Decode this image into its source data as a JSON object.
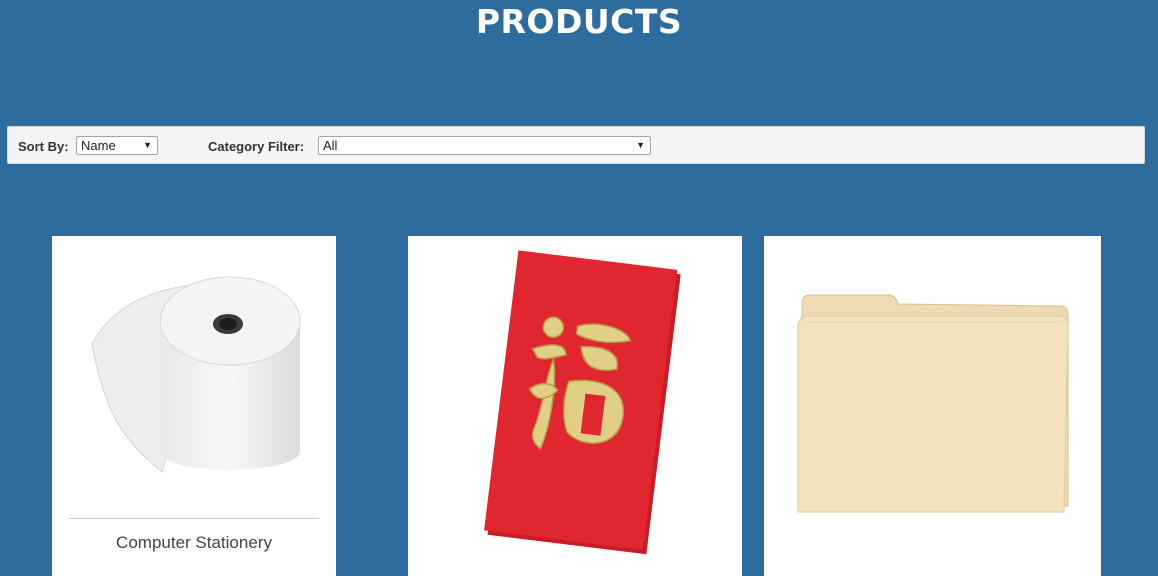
{
  "page": {
    "title": "PRODUCTS"
  },
  "filters": {
    "sort_label": "Sort By:",
    "sort_value": "Name",
    "category_label": "Category Filter:",
    "category_value": "All"
  },
  "products": [
    {
      "name": "Computer Stationery",
      "image": "paper-roll"
    },
    {
      "name": "",
      "image": "red-envelope"
    },
    {
      "name": "",
      "image": "manila-folder"
    }
  ],
  "colors": {
    "background": "#2e6c9e",
    "filter_bar": "#f4f4f4",
    "card": "#ffffff",
    "envelope_red": "#e0262f",
    "envelope_gold": "#e2cf86",
    "folder": "#f2e2bd"
  }
}
